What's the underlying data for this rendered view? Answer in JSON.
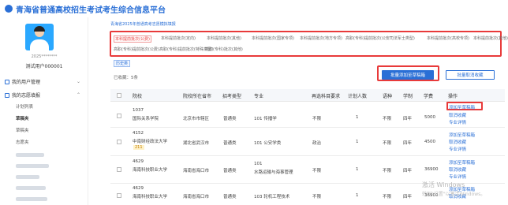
{
  "header": {
    "title": "青海省普通高校招生考试考生综合信息平台"
  },
  "user": {
    "id": "2025********",
    "name": "测试用户000001"
  },
  "nav": {
    "my_user": "我的用户管理",
    "my_volunteer": "我的志愿填报",
    "subs": [
      "计划列表",
      "草稿夹",
      "草稿夹",
      "志愿夹"
    ]
  },
  "breadcrumb": "青海省2025年普通高考志愿模拟填报",
  "filters": [
    "本科提前批次(公费)",
    "本科提前批次(定向)",
    "本科提前批次(其他)",
    "本科提前批次(国家专项)",
    "本科提前批次(地方专项)",
    "高职(专科)提前批次(公安司法军士类型)",
    "本科提前批次(高校专项)",
    "本科提前批次(其他)",
    "高职(专科)提前批次(公费)",
    "高职(专科)提前批次(特殊类型)",
    "高职(专科)批次(其他)"
  ],
  "history_tab": "历史类",
  "selected_text": "已收藏：5条",
  "buttons": {
    "batch_add": "批量添加至草稿箱",
    "batch_cancel": "批量取消收藏"
  },
  "table": {
    "headers": [
      "院校",
      "院校所在省市",
      "招考类型",
      "专业",
      "再选科目要求",
      "计划人数",
      "语种",
      "学制",
      "学费",
      "操作"
    ],
    "rows": [
      {
        "code": "1037",
        "name": "国际关系学院",
        "location": "北京市市辖区",
        "type": "普通类",
        "major": "101 传播学",
        "require": "不限",
        "plan": "1",
        "lang": "不限",
        "years": "四年",
        "fee": "5000"
      },
      {
        "code": "4152",
        "name": "中南财经政法大学",
        "badge": "211",
        "location": "湖北省武汉市",
        "type": "普通类",
        "major": "101 公安学类",
        "require": "政治",
        "plan": "1",
        "lang": "不限",
        "years": "四年",
        "fee": "4500"
      },
      {
        "code": "4629",
        "name": "海南科技职业大学",
        "location": "海南省海口市",
        "type": "普通类",
        "major_line1": "101",
        "major_line2": "水路运输与海事管理",
        "require": "不限",
        "plan": "1",
        "lang": "不限",
        "years": "四年",
        "fee": "36900"
      },
      {
        "code": "4629",
        "name": "海南科技职业大学",
        "location": "海南省海口市",
        "type": "普通类",
        "major": "103 轮机工程技术",
        "require": "不限",
        "plan": "1",
        "lang": "不限",
        "years": "四年",
        "fee": "36900"
      }
    ],
    "ops": {
      "add": "添加至草稿箱",
      "cancel": "取消收藏",
      "detail": "专业详情"
    }
  },
  "watermark": {
    "line1": "激活 Windows",
    "line2": "转到\"设置\"以激活Windows。"
  }
}
